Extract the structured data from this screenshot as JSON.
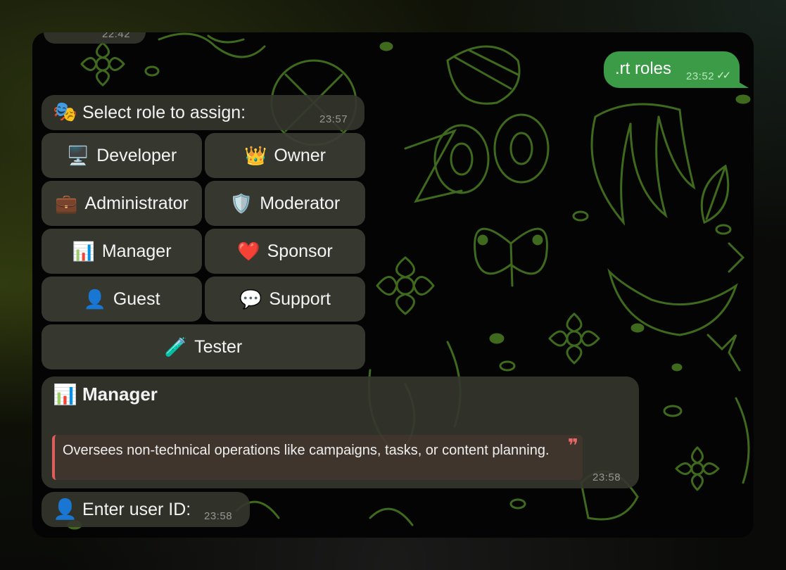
{
  "chat": {
    "previous_message": {
      "time": "22:42"
    },
    "sent_message": {
      "text": ".rt roles",
      "time": "23:52",
      "read_ticks": "✓✓"
    },
    "role_prompt": {
      "emoji": "🎭",
      "text": "Select role to assign:",
      "time": "23:57"
    },
    "role_buttons": [
      {
        "emoji": "🖥️",
        "label": "Developer"
      },
      {
        "emoji": "👑",
        "label": "Owner"
      },
      {
        "emoji": "💼",
        "label": "Administrator"
      },
      {
        "emoji": "🛡️",
        "label": "Moderator"
      },
      {
        "emoji": "📊",
        "label": "Manager"
      },
      {
        "emoji": "❤️",
        "label": "Sponsor"
      },
      {
        "emoji": "👤",
        "label": "Guest"
      },
      {
        "emoji": "💬",
        "label": "Support"
      },
      {
        "emoji": "🧪",
        "label": "Tester"
      }
    ],
    "role_details": {
      "emoji": "📊",
      "title": "Manager",
      "description": "Oversees non-technical operations like campaigns, tasks, or content planning.",
      "quote_mark": "❞",
      "time": "23:58"
    },
    "user_id_prompt": {
      "emoji": "👤",
      "text": "Enter user ID:",
      "time": "23:58"
    }
  },
  "colors": {
    "sent_bubble": "#3b9b46",
    "received_bubble": "#34362e",
    "quote_accent": "#e05d5d",
    "wallpaper_lines": "#3f6a1e"
  }
}
